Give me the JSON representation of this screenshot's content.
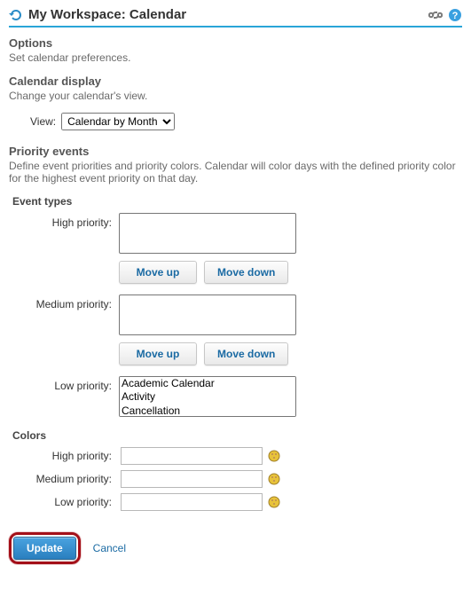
{
  "header": {
    "title": "My Workspace: Calendar"
  },
  "options": {
    "title": "Options",
    "desc": "Set calendar preferences."
  },
  "display": {
    "title": "Calendar display",
    "desc": "Change your calendar's view.",
    "view_label": "View:",
    "view_selected": "Calendar by Month",
    "view_options": [
      "Calendar by Month"
    ]
  },
  "priority": {
    "title": "Priority events",
    "desc": "Define event priorities and priority colors. Calendar will color days with the defined priority color for the highest event priority on that day.",
    "event_types_title": "Event types",
    "labels": {
      "high": "High priority:",
      "medium": "Medium priority:",
      "low": "Low priority:"
    },
    "lists": {
      "high": [],
      "medium": [],
      "low": [
        "Academic Calendar",
        "Activity",
        "Cancellation"
      ]
    },
    "buttons": {
      "move_up": "Move up",
      "move_down": "Move down"
    }
  },
  "colors": {
    "title": "Colors",
    "labels": {
      "high": "High priority:",
      "medium": "Medium priority:",
      "low": "Low priority:"
    },
    "values": {
      "high": "",
      "medium": "",
      "low": ""
    }
  },
  "footer": {
    "update": "Update",
    "cancel": "Cancel"
  }
}
